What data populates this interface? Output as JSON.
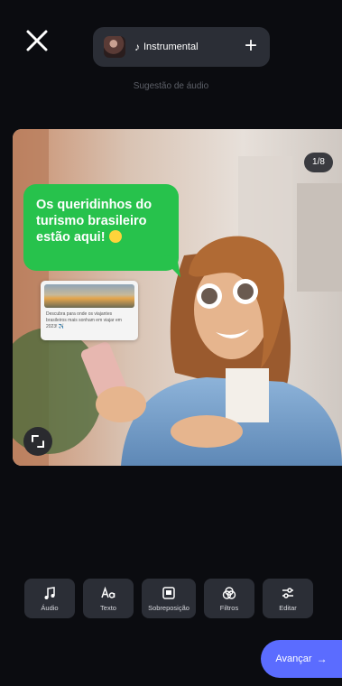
{
  "header": {
    "close_icon": "close-icon",
    "audio": {
      "label": "Instrumental",
      "note_icon": "♪",
      "add_icon": "+"
    },
    "audio_suggestion": "Sugestão de áudio"
  },
  "preview": {
    "media_count": "1/8",
    "bubble_text": "Os queridinhos do turismo brasileiro estão aqui!",
    "card_text": "Descubra para onde os viajantes brasileiros mais sonham em viajar em 2023! ✈️",
    "resize_icon": "expand-icon"
  },
  "toolbar": {
    "items": [
      {
        "label": "Áudio",
        "icon": "music-icon"
      },
      {
        "label": "Texto",
        "icon": "text-icon"
      },
      {
        "label": "Sobreposição",
        "icon": "overlay-icon"
      },
      {
        "label": "Filtros",
        "icon": "filter-icon"
      },
      {
        "label": "Editar",
        "icon": "sliders-icon"
      }
    ]
  },
  "footer": {
    "next_label": "Avançar",
    "next_arrow": "→"
  },
  "colors": {
    "background": "#0b0c10",
    "bubble": "#27c24c",
    "accent": "#5b6cff",
    "tool_bg": "#2b2e36"
  }
}
